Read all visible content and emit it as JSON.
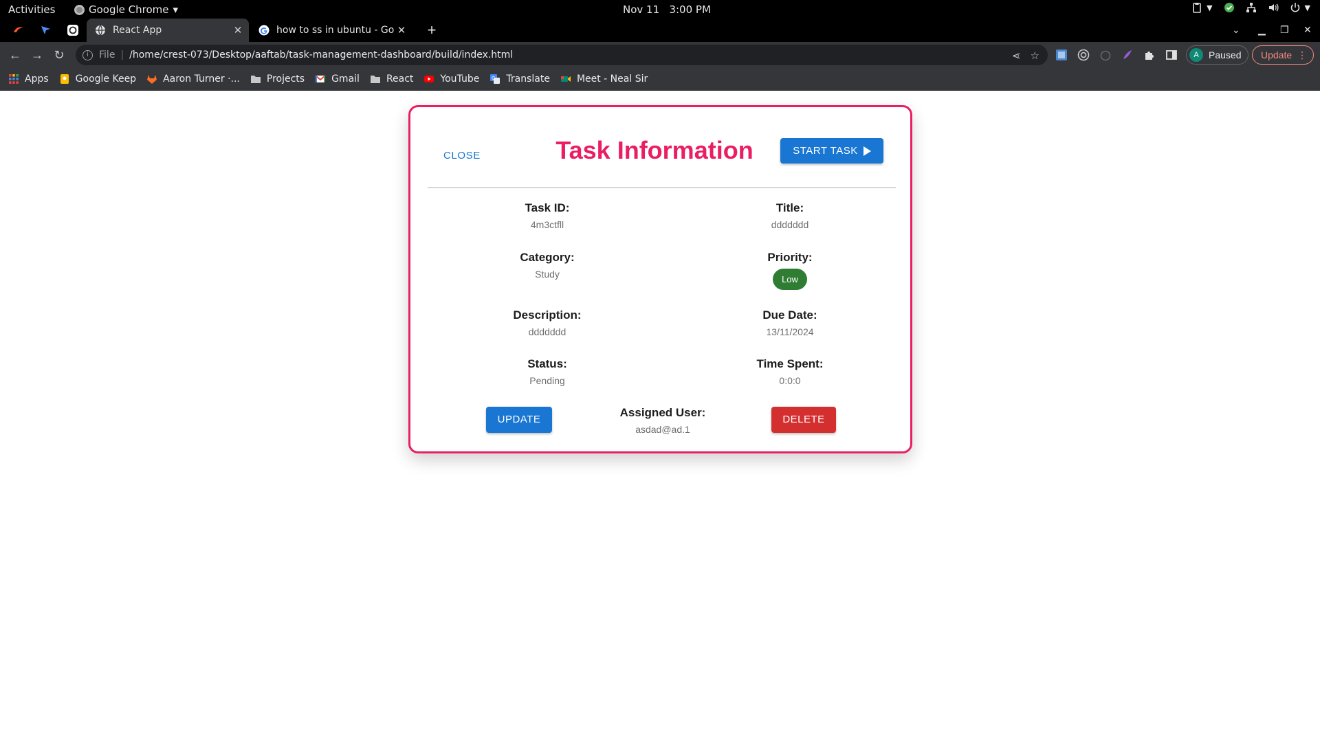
{
  "system_bar": {
    "activities": "Activities",
    "app_name": "Google Chrome",
    "date": "Nov 11",
    "time": "3:00 PM"
  },
  "tabs": [
    {
      "title": "React App",
      "favicon": "globe-icon",
      "active": true
    },
    {
      "title": "how to ss in ubuntu - Goo",
      "favicon": "google-icon",
      "active": false
    }
  ],
  "address_bar": {
    "scheme_label": "File",
    "url": "/home/crest-073/Desktop/aaftab/task-management-dashboard/build/index.html"
  },
  "profile": {
    "initial": "A",
    "status": "Paused"
  },
  "update_button": "Update",
  "bookmarks": [
    {
      "label": "Apps",
      "icon": "apps-grid-icon"
    },
    {
      "label": "Google Keep",
      "icon": "keep-icon"
    },
    {
      "label": "Aaron Turner ·...",
      "icon": "gitlab-icon"
    },
    {
      "label": "Projects",
      "icon": "folder-icon"
    },
    {
      "label": "Gmail",
      "icon": "gmail-icon"
    },
    {
      "label": "React",
      "icon": "folder-icon"
    },
    {
      "label": "YouTube",
      "icon": "youtube-icon"
    },
    {
      "label": "Translate",
      "icon": "translate-icon"
    },
    {
      "label": "Meet - Neal Sir",
      "icon": "meet-icon"
    }
  ],
  "modal": {
    "close_label": "CLOSE",
    "title": "Task Information",
    "start_label": "START TASK",
    "fields": {
      "task_id": {
        "label": "Task ID:",
        "value": "4m3ctfll"
      },
      "title": {
        "label": "Title:",
        "value": "ddddddd"
      },
      "category": {
        "label": "Category:",
        "value": "Study"
      },
      "priority": {
        "label": "Priority:",
        "value": "Low"
      },
      "description": {
        "label": "Description:",
        "value": "ddddddd"
      },
      "due_date": {
        "label": "Due Date:",
        "value": "13/11/2024"
      },
      "status": {
        "label": "Status:",
        "value": "Pending"
      },
      "time_spent": {
        "label": "Time Spent:",
        "value": "0:0:0"
      },
      "assigned_user": {
        "label": "Assigned User:",
        "value": "asdad@ad.1"
      }
    },
    "update_label": "UPDATE",
    "delete_label": "DELETE"
  },
  "colors": {
    "accent_pink": "#e91e63",
    "primary_blue": "#1976d2",
    "danger_red": "#d32f2f",
    "priority_low_green": "#2e7d32"
  }
}
